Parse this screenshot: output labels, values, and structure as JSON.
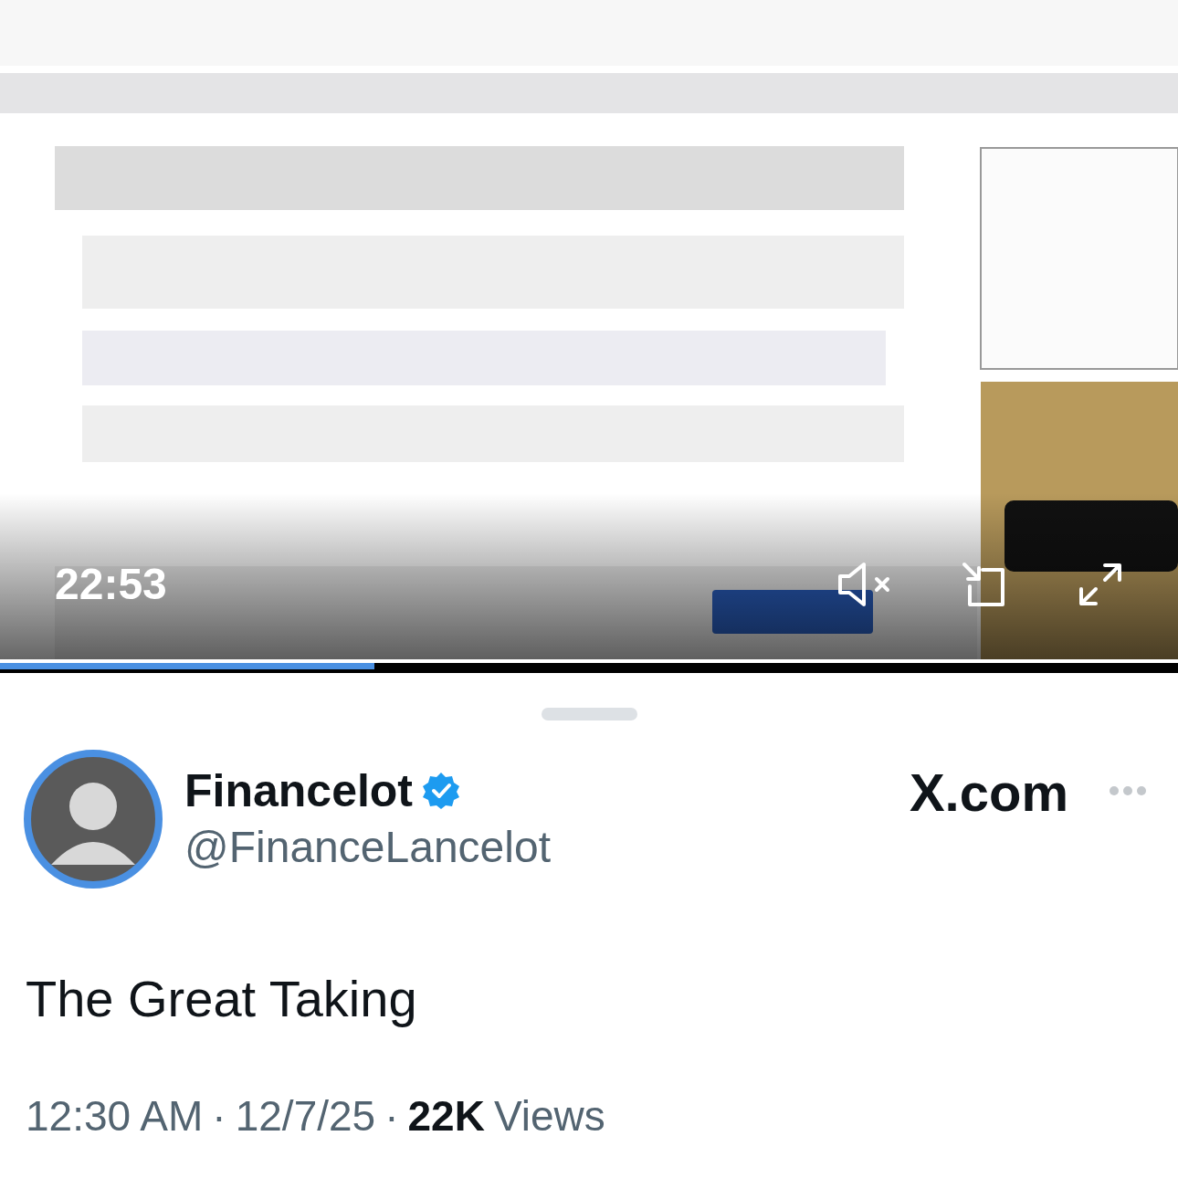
{
  "video": {
    "kind": "picture",
    "elapsed": "22:53",
    "muted": true,
    "level": 0.318
  },
  "author": {
    "name": "Financelot",
    "verified": true,
    "handle": "@FinanceLancelot"
  },
  "source": "X.com",
  "text": "The Great Taking",
  "meta": {
    "time": "12:30 AM",
    "separator_1": "·",
    "date": "12/7/25",
    "separator_2": "·",
    "views_count": "22K",
    "views_label": "Views"
  }
}
